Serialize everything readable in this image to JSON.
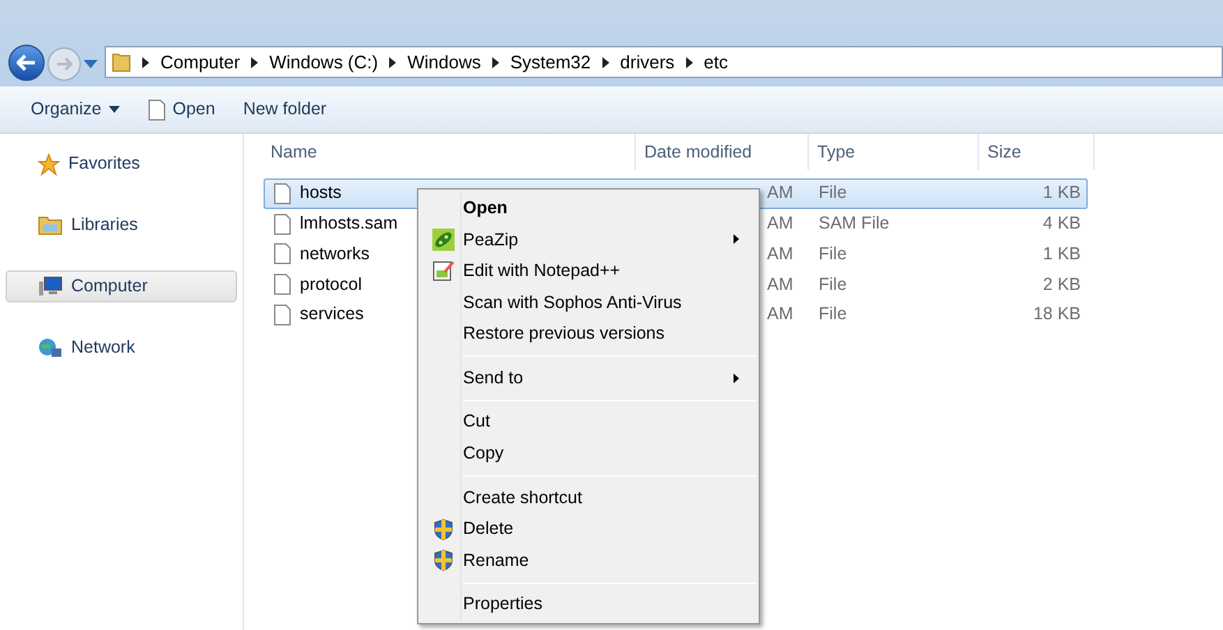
{
  "address_bar": {
    "crumbs": [
      "Computer",
      "Windows (C:)",
      "Windows",
      "System32",
      "drivers",
      "etc"
    ]
  },
  "toolbar": {
    "buttons": [
      {
        "label": "Organize",
        "kind": "dropdown"
      },
      {
        "label": "Open",
        "kind": "file"
      },
      {
        "label": "New folder",
        "kind": "plain"
      }
    ]
  },
  "sidebar": {
    "items": [
      {
        "label": "Favorites",
        "kind": "star",
        "selected": false
      },
      {
        "label": "Libraries",
        "kind": "library",
        "selected": false
      },
      {
        "label": "Computer",
        "kind": "computer",
        "selected": true
      },
      {
        "label": "Network",
        "kind": "network",
        "selected": false
      }
    ]
  },
  "table": {
    "columns": [
      "Name",
      "Date modified",
      "Type",
      "Size"
    ],
    "rows": [
      {
        "name": "hosts",
        "date_modified": "AM",
        "type": "File",
        "size": "1 KB",
        "selected": true
      },
      {
        "name": "lmhosts.sam",
        "date_modified": "AM",
        "type": "SAM File",
        "size": "4 KB",
        "selected": false
      },
      {
        "name": "networks",
        "date_modified": "AM",
        "type": "File",
        "size": "1 KB",
        "selected": false
      },
      {
        "name": "protocol",
        "date_modified": "AM",
        "type": "File",
        "size": "2 KB",
        "selected": false
      },
      {
        "name": "services",
        "date_modified": "AM",
        "type": "File",
        "size": "18 KB",
        "selected": false
      }
    ]
  },
  "context_menu": {
    "groups": [
      [
        {
          "label": "Open",
          "bold": true
        },
        {
          "label": "PeaZip",
          "kind": "peazip",
          "submenu": true
        },
        {
          "label": "Edit with Notepad++",
          "kind": "notepad"
        },
        {
          "label": "Scan with Sophos Anti-Virus"
        },
        {
          "label": "Restore previous versions"
        }
      ],
      [
        {
          "label": "Send to",
          "submenu": true
        }
      ],
      [
        {
          "label": "Cut"
        },
        {
          "label": "Copy"
        }
      ],
      [
        {
          "label": "Create shortcut"
        },
        {
          "label": "Delete",
          "kind": "shield"
        },
        {
          "label": "Rename",
          "kind": "shield"
        }
      ],
      [
        {
          "label": "Properties"
        }
      ]
    ]
  }
}
